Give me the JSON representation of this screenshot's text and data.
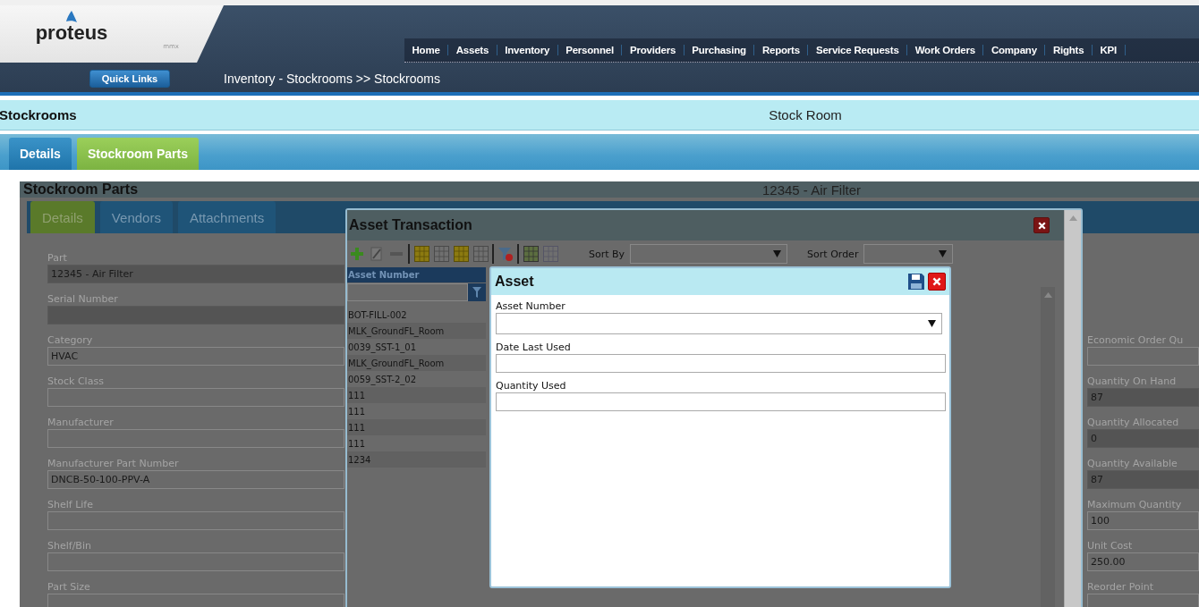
{
  "header": {
    "logo": {
      "name": "proteus",
      "sub": "mmx"
    },
    "nav": [
      "Home",
      "Assets",
      "Inventory",
      "Personnel",
      "Providers",
      "Purchasing",
      "Reports",
      "Service Requests",
      "Work Orders",
      "Company",
      "Rights",
      "KPI"
    ],
    "quick_links": "Quick Links",
    "breadcrumb": "Inventory - Stockrooms >> Stockrooms"
  },
  "title_bar": {
    "title": "Stockrooms",
    "subtitle": "Stock Room"
  },
  "tabs": [
    {
      "label": "Details",
      "selected": false
    },
    {
      "label": "Stockroom Parts",
      "selected": true
    }
  ],
  "panel": {
    "title": "Stockroom Parts",
    "record": "12345 - Air Filter",
    "tabs": [
      {
        "label": "Details",
        "selected": true
      },
      {
        "label": "Vendors",
        "selected": false
      },
      {
        "label": "Attachments",
        "selected": false
      }
    ],
    "left_fields": [
      {
        "label": "Part",
        "value": "12345 - Air Filter",
        "readonly": true
      },
      {
        "label": "Serial Number",
        "readonly": true
      },
      {
        "label": "Category",
        "value": "HVAC",
        "readonly": false
      },
      {
        "label": "Stock Class",
        "readonly": false
      },
      {
        "label": "Manufacturer",
        "readonly": false
      },
      {
        "label": "Manufacturer Part Number",
        "value": "DNCB-50-100-PPV-A",
        "readonly": false
      },
      {
        "label": "Shelf Life",
        "readonly": false
      },
      {
        "label": "Shelf/Bin",
        "readonly": false
      },
      {
        "label": "Part Size",
        "readonly": false
      }
    ],
    "right_fields": [
      {
        "label": "Economic Order Qu",
        "readonly": false
      },
      {
        "label": "Quantity On Hand",
        "value": "87",
        "readonly": true
      },
      {
        "label": "Quantity Allocated",
        "value": "0",
        "readonly": true
      },
      {
        "label": "Quantity Available",
        "value": "87",
        "readonly": true
      },
      {
        "label": "Maximum Quantity",
        "value": "100",
        "readonly": false
      },
      {
        "label": "Unit Cost",
        "value": "250.00",
        "readonly": false
      },
      {
        "label": "Reorder Point",
        "readonly": false
      }
    ]
  },
  "asset_transaction": {
    "title": "Asset Transaction",
    "sort_by": "Sort By",
    "sort_order": "Sort Order",
    "grid": {
      "column": "Asset Number",
      "rows": [
        "BOT-FILL-002",
        "MLK_GroundFL_Room",
        "0039_SST-1_01",
        "MLK_GroundFL_Room",
        "0059_SST-2_02",
        "111",
        "111",
        "111",
        "111",
        "1234"
      ]
    }
  },
  "asset_dialog": {
    "title": "Asset",
    "fields": [
      {
        "label": "Asset Number",
        "kind": "select"
      },
      {
        "label": "Date Last Used",
        "kind": "text"
      },
      {
        "label": "Quantity Used",
        "kind": "text"
      }
    ]
  }
}
